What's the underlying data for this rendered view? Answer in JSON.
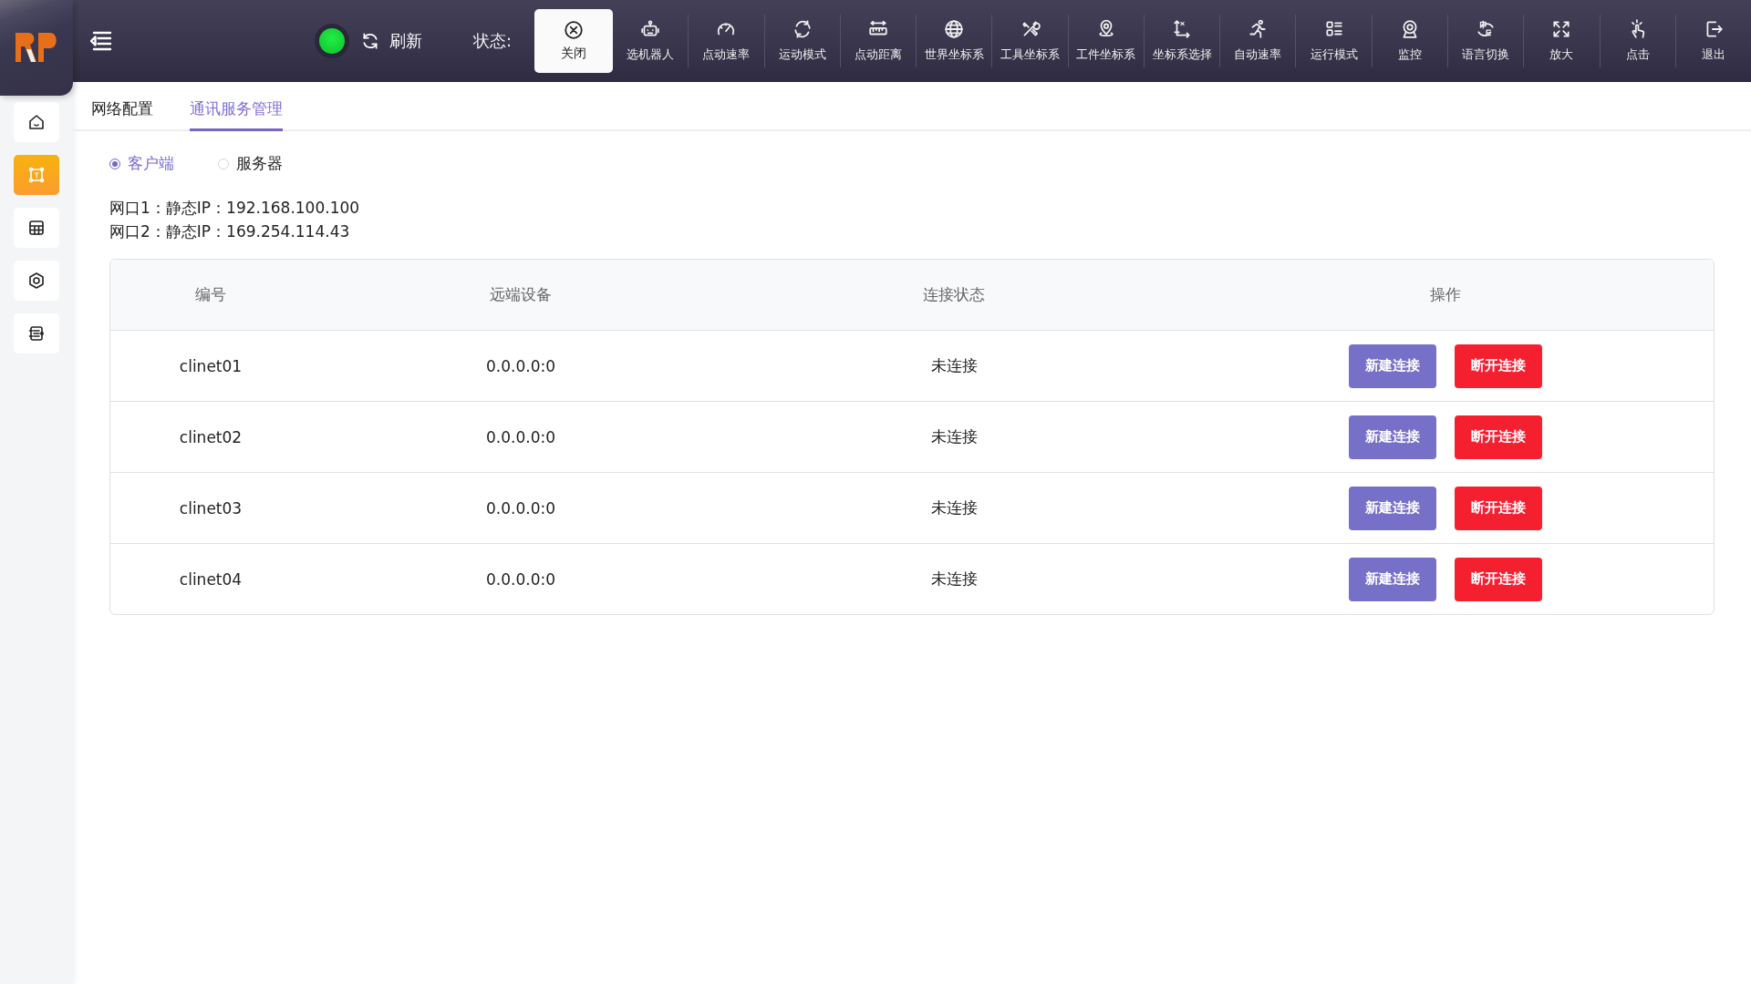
{
  "topbar": {
    "online": true,
    "refresh": "刷新",
    "status_label": "状态:",
    "close_button": "关闭",
    "tools": [
      {
        "kind": "robot",
        "label": "选机器人"
      },
      {
        "kind": "gauge",
        "label": "点动速率"
      },
      {
        "kind": "cycle",
        "label": "运动模式"
      },
      {
        "kind": "ruler",
        "label": "点动距离"
      },
      {
        "kind": "globe",
        "label": "世界坐标系"
      },
      {
        "kind": "tools",
        "label": "工具坐标系"
      },
      {
        "kind": "pin",
        "label": "工件坐标系"
      },
      {
        "kind": "axes",
        "label": "坐标系选择"
      },
      {
        "kind": "runner",
        "label": "自动速率"
      },
      {
        "kind": "list",
        "label": "运行模式"
      },
      {
        "kind": "camera",
        "label": "监控"
      },
      {
        "kind": "language",
        "label": "语言切换"
      },
      {
        "kind": "expand",
        "label": "放大"
      },
      {
        "kind": "tap",
        "label": "点击"
      },
      {
        "kind": "exit",
        "label": "退出"
      }
    ]
  },
  "sidebar": {
    "items": [
      {
        "kind": "home",
        "selected": false
      },
      {
        "kind": "frame",
        "selected": true
      },
      {
        "kind": "grid",
        "selected": false
      },
      {
        "kind": "hex",
        "selected": false
      },
      {
        "kind": "notes",
        "selected": false
      }
    ]
  },
  "tabs": [
    {
      "label": "网络配置",
      "selected": false
    },
    {
      "label": "通讯服务管理",
      "selected": true
    }
  ],
  "mode": [
    {
      "label": "客户端",
      "selected": true
    },
    {
      "label": "服务器",
      "selected": false
    }
  ],
  "ports": [
    "网口1：静态IP：192.168.100.100",
    "网口2：静态IP：169.254.114.43"
  ],
  "table": {
    "columns": [
      "编号",
      "远端设备",
      "连接状态",
      "操作"
    ],
    "rows": [
      {
        "id": "clinet01",
        "remote": "0.0.0.0:0",
        "state": "未连接",
        "connect": "新建连接",
        "disconnect": "断开连接"
      },
      {
        "id": "clinet02",
        "remote": "0.0.0.0:0",
        "state": "未连接",
        "connect": "新建连接",
        "disconnect": "断开连接"
      },
      {
        "id": "clinet03",
        "remote": "0.0.0.0:0",
        "state": "未连接",
        "connect": "新建连接",
        "disconnect": "断开连接"
      },
      {
        "id": "clinet04",
        "remote": "0.0.0.0:0",
        "state": "未连接",
        "connect": "新建连接",
        "disconnect": "断开连接"
      }
    ]
  }
}
